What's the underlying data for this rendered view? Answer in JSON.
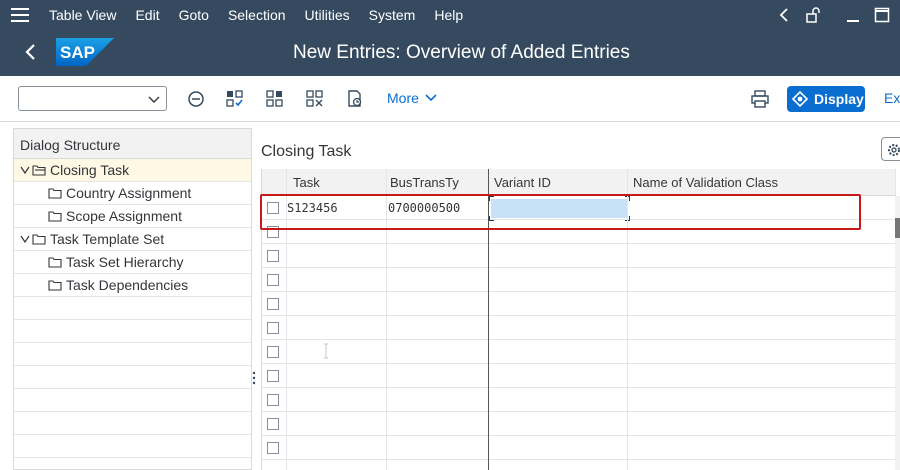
{
  "menubar": {
    "items": [
      "Table View",
      "Edit",
      "Goto",
      "Selection",
      "Utilities",
      "System",
      "Help"
    ]
  },
  "header": {
    "logo_text": "SAP",
    "title": "New Entries: Overview of Added Entries"
  },
  "toolbar": {
    "select_value": "",
    "more_label": "More",
    "display_label": "Display",
    "exit_label": "Ex"
  },
  "dialog_structure": {
    "title": "Dialog Structure",
    "items": [
      {
        "label": "Closing Task",
        "level": 0,
        "expanded": true,
        "selected": true
      },
      {
        "label": "Country Assignment",
        "level": 1
      },
      {
        "label": "Scope Assignment",
        "level": 1
      },
      {
        "label": "Task Template Set",
        "level": 0,
        "expanded": true
      },
      {
        "label": "Task Set Hierarchy",
        "level": 1
      },
      {
        "label": "Task Dependencies",
        "level": 1
      }
    ]
  },
  "table": {
    "title": "Closing Task",
    "columns": [
      "Task",
      "BusTransTy",
      "Variant ID",
      "Name of Validation Class"
    ],
    "rows": [
      [
        "S123456",
        "0700000500",
        "",
        ""
      ]
    ],
    "empty_rows": 11
  },
  "colors": {
    "shell": "#354a5f",
    "accent": "#0a6ed1",
    "highlight_border": "#c81919",
    "edit_cell": "#c8e1f7"
  }
}
